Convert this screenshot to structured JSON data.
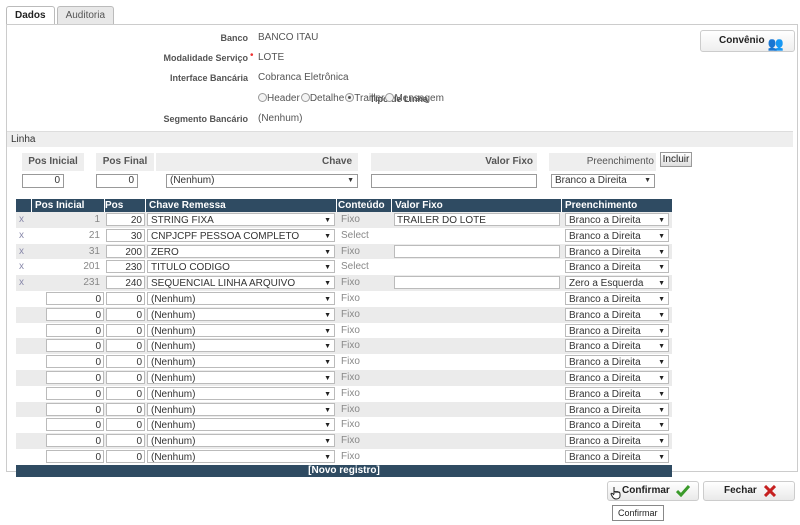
{
  "tabs": [
    "Dados",
    "Auditoria"
  ],
  "form": {
    "banco_label": "Banco",
    "banco_value": "BANCO ITAU",
    "modalidade_label": "Modalidade Serviço",
    "modalidade_value": "LOTE",
    "interface_label": "Interface Bancária",
    "interface_value": "Cobranca Eletrônica",
    "tipo_label": "Tipo de Linha",
    "tipo_options": [
      "Header",
      "Detalhe",
      "Trailler",
      "Mensagem"
    ],
    "tipo_selected": "Trailler",
    "segmento_label": "Segmento Bancário",
    "segmento_value": "(Nenhum)"
  },
  "convenio_button": "Convênio",
  "section_title": "Linha",
  "add_form": {
    "pos_inicial_label": "Pos Inicial",
    "pos_final_label": "Pos Final",
    "chave_label": "Chave",
    "valor_fixo_label": "Valor Fixo",
    "preenchimento_label": "Preenchimento",
    "pos_inicial": "0",
    "pos_final": "0",
    "chave": "(Nenhum)",
    "valor_fixo": "",
    "preenchimento": "Branco a Direita",
    "incluir": "Incluir"
  },
  "grid": {
    "headers": [
      "Pos Inicial",
      "Pos Final",
      "Chave Remessa",
      "Conteúdo",
      "Valor Fixo",
      "Preenchimento"
    ],
    "rows": [
      {
        "del": "x",
        "ini": "1",
        "fim": "20",
        "chave": "STRING FIXA",
        "conteudo": "Fixo",
        "valor": "TRAILER DO LOTE",
        "valor_input": true,
        "pre": "Branco a Direita",
        "locked": true
      },
      {
        "del": "x",
        "ini": "21",
        "fim": "30",
        "chave": "CNPJCPF PESSOA COMPLETO",
        "conteudo": "Select",
        "valor": "",
        "valor_input": false,
        "pre": "Branco a Direita",
        "locked": true
      },
      {
        "del": "x",
        "ini": "31",
        "fim": "200",
        "chave": "ZERO",
        "conteudo": "Fixo",
        "valor": "",
        "valor_input": true,
        "pre": "Branco a Direita",
        "locked": true
      },
      {
        "del": "x",
        "ini": "201",
        "fim": "230",
        "chave": "TITULO CODIGO",
        "conteudo": "Select",
        "valor": "",
        "valor_input": false,
        "pre": "Branco a Direita",
        "locked": true
      },
      {
        "del": "x",
        "ini": "231",
        "fim": "240",
        "chave": "SEQUENCIAL LINHA ARQUIVO",
        "conteudo": "Fixo",
        "valor": "",
        "valor_input": true,
        "pre": "Zero a Esquerda",
        "locked": true
      },
      {
        "del": "",
        "ini": "0",
        "fim": "0",
        "chave": "(Nenhum)",
        "conteudo": "Fixo",
        "valor": "",
        "valor_input": false,
        "pre": "Branco a Direita",
        "locked": false
      },
      {
        "del": "",
        "ini": "0",
        "fim": "0",
        "chave": "(Nenhum)",
        "conteudo": "Fixo",
        "valor": "",
        "valor_input": false,
        "pre": "Branco a Direita",
        "locked": false
      },
      {
        "del": "",
        "ini": "0",
        "fim": "0",
        "chave": "(Nenhum)",
        "conteudo": "Fixo",
        "valor": "",
        "valor_input": false,
        "pre": "Branco a Direita",
        "locked": false
      },
      {
        "del": "",
        "ini": "0",
        "fim": "0",
        "chave": "(Nenhum)",
        "conteudo": "Fixo",
        "valor": "",
        "valor_input": false,
        "pre": "Branco a Direita",
        "locked": false
      },
      {
        "del": "",
        "ini": "0",
        "fim": "0",
        "chave": "(Nenhum)",
        "conteudo": "Fixo",
        "valor": "",
        "valor_input": false,
        "pre": "Branco a Direita",
        "locked": false
      },
      {
        "del": "",
        "ini": "0",
        "fim": "0",
        "chave": "(Nenhum)",
        "conteudo": "Fixo",
        "valor": "",
        "valor_input": false,
        "pre": "Branco a Direita",
        "locked": false
      },
      {
        "del": "",
        "ini": "0",
        "fim": "0",
        "chave": "(Nenhum)",
        "conteudo": "Fixo",
        "valor": "",
        "valor_input": false,
        "pre": "Branco a Direita",
        "locked": false
      },
      {
        "del": "",
        "ini": "0",
        "fim": "0",
        "chave": "(Nenhum)",
        "conteudo": "Fixo",
        "valor": "",
        "valor_input": false,
        "pre": "Branco a Direita",
        "locked": false
      },
      {
        "del": "",
        "ini": "0",
        "fim": "0",
        "chave": "(Nenhum)",
        "conteudo": "Fixo",
        "valor": "",
        "valor_input": false,
        "pre": "Branco a Direita",
        "locked": false
      },
      {
        "del": "",
        "ini": "0",
        "fim": "0",
        "chave": "(Nenhum)",
        "conteudo": "Fixo",
        "valor": "",
        "valor_input": false,
        "pre": "Branco a Direita",
        "locked": false
      },
      {
        "del": "",
        "ini": "0",
        "fim": "0",
        "chave": "(Nenhum)",
        "conteudo": "Fixo",
        "valor": "",
        "valor_input": false,
        "pre": "Branco a Direita",
        "locked": false
      }
    ],
    "footer": "[Novo registro]"
  },
  "buttons": {
    "confirmar": "Confirmar",
    "fechar": "Fechar"
  },
  "tooltip": "Confirmar",
  "icons": {
    "convenio": "people-icon",
    "confirmar": "checkmark-icon",
    "fechar": "x-icon",
    "cursor": "hand-cursor-icon"
  },
  "colors": {
    "grid_header": "#2f4b62",
    "confirm_green": "#3a9a2a",
    "close_red": "#c62020"
  }
}
